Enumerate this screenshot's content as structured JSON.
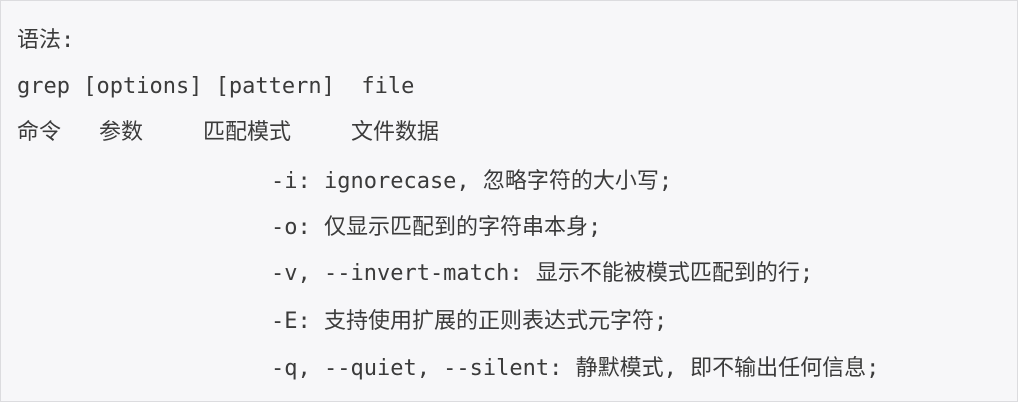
{
  "syntax_label": "语法:",
  "usage": "grep [options] [pattern]  file",
  "columns": {
    "command": "命令",
    "params": "参数",
    "pattern": "匹配模式",
    "file": "文件数据"
  },
  "options": [
    "-i: ignorecase, 忽略字符的大小写;",
    "-o: 仅显示匹配到的字符串本身;",
    "-v, --invert-match: 显示不能被模式匹配到的行;",
    "-E: 支持使用扩展的正则表达式元字符;",
    "-q, --quiet, --silent: 静默模式, 即不输出任何信息;"
  ]
}
